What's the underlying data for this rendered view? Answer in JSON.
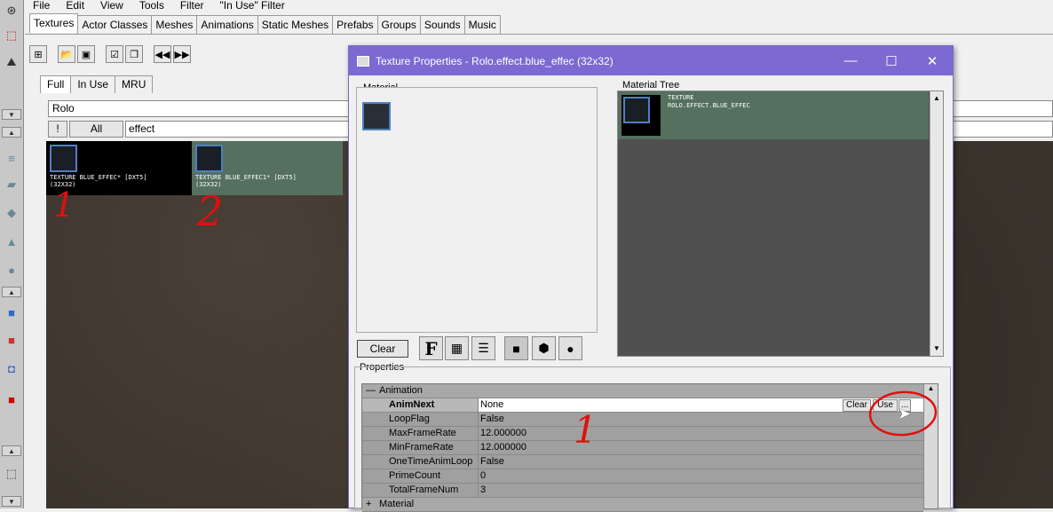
{
  "menu": [
    "File",
    "Edit",
    "View",
    "Tools",
    "Filter",
    "\"In Use\" Filter"
  ],
  "tabs": [
    "Textures",
    "Actor Classes",
    "Meshes",
    "Animations",
    "Static Meshes",
    "Prefabs",
    "Groups",
    "Sounds",
    "Music"
  ],
  "subtabs": [
    "Full",
    "In Use",
    "MRU"
  ],
  "package_field": "Rolo",
  "filter_excl": "!",
  "filter_all": "All",
  "filter_text": "effect",
  "thumbs": [
    {
      "label": "TEXTURE BLUE_EFFEC* [DXT5]",
      "size": "(32X32)"
    },
    {
      "label": "TEXTURE BLUE_EFFEC1* [DXT5]",
      "size": "(32X32)"
    }
  ],
  "annotations": {
    "a1": "1",
    "a2": "2",
    "a3": "1"
  },
  "dialog": {
    "title": "Texture Properties - Rolo.effect.blue_effec (32x32)",
    "material_legend": "Material",
    "tree_legend": "Material Tree",
    "tree_line1": "TEXTURE",
    "tree_line2": "ROLO.EFFECT.BLUE_EFFEC",
    "clear_label": "Clear",
    "properties_legend": "Properties",
    "category": "Animation",
    "category2": "Material",
    "props": [
      {
        "name": "AnimNext",
        "value": "None"
      },
      {
        "name": "LoopFlag",
        "value": "False"
      },
      {
        "name": "MaxFrameRate",
        "value": "12.000000"
      },
      {
        "name": "MinFrameRate",
        "value": "12.000000"
      },
      {
        "name": "OneTimeAnimLoop",
        "value": "False"
      },
      {
        "name": "PrimeCount",
        "value": "0"
      },
      {
        "name": "TotalFrameNum",
        "value": "3"
      }
    ],
    "btn_clear": "Clear",
    "btn_use": "Use",
    "btn_dots": "..."
  },
  "colors": {
    "titlebar": "#7c69d2",
    "annotation": "#e01010",
    "selected_thumb": "#55705f"
  }
}
